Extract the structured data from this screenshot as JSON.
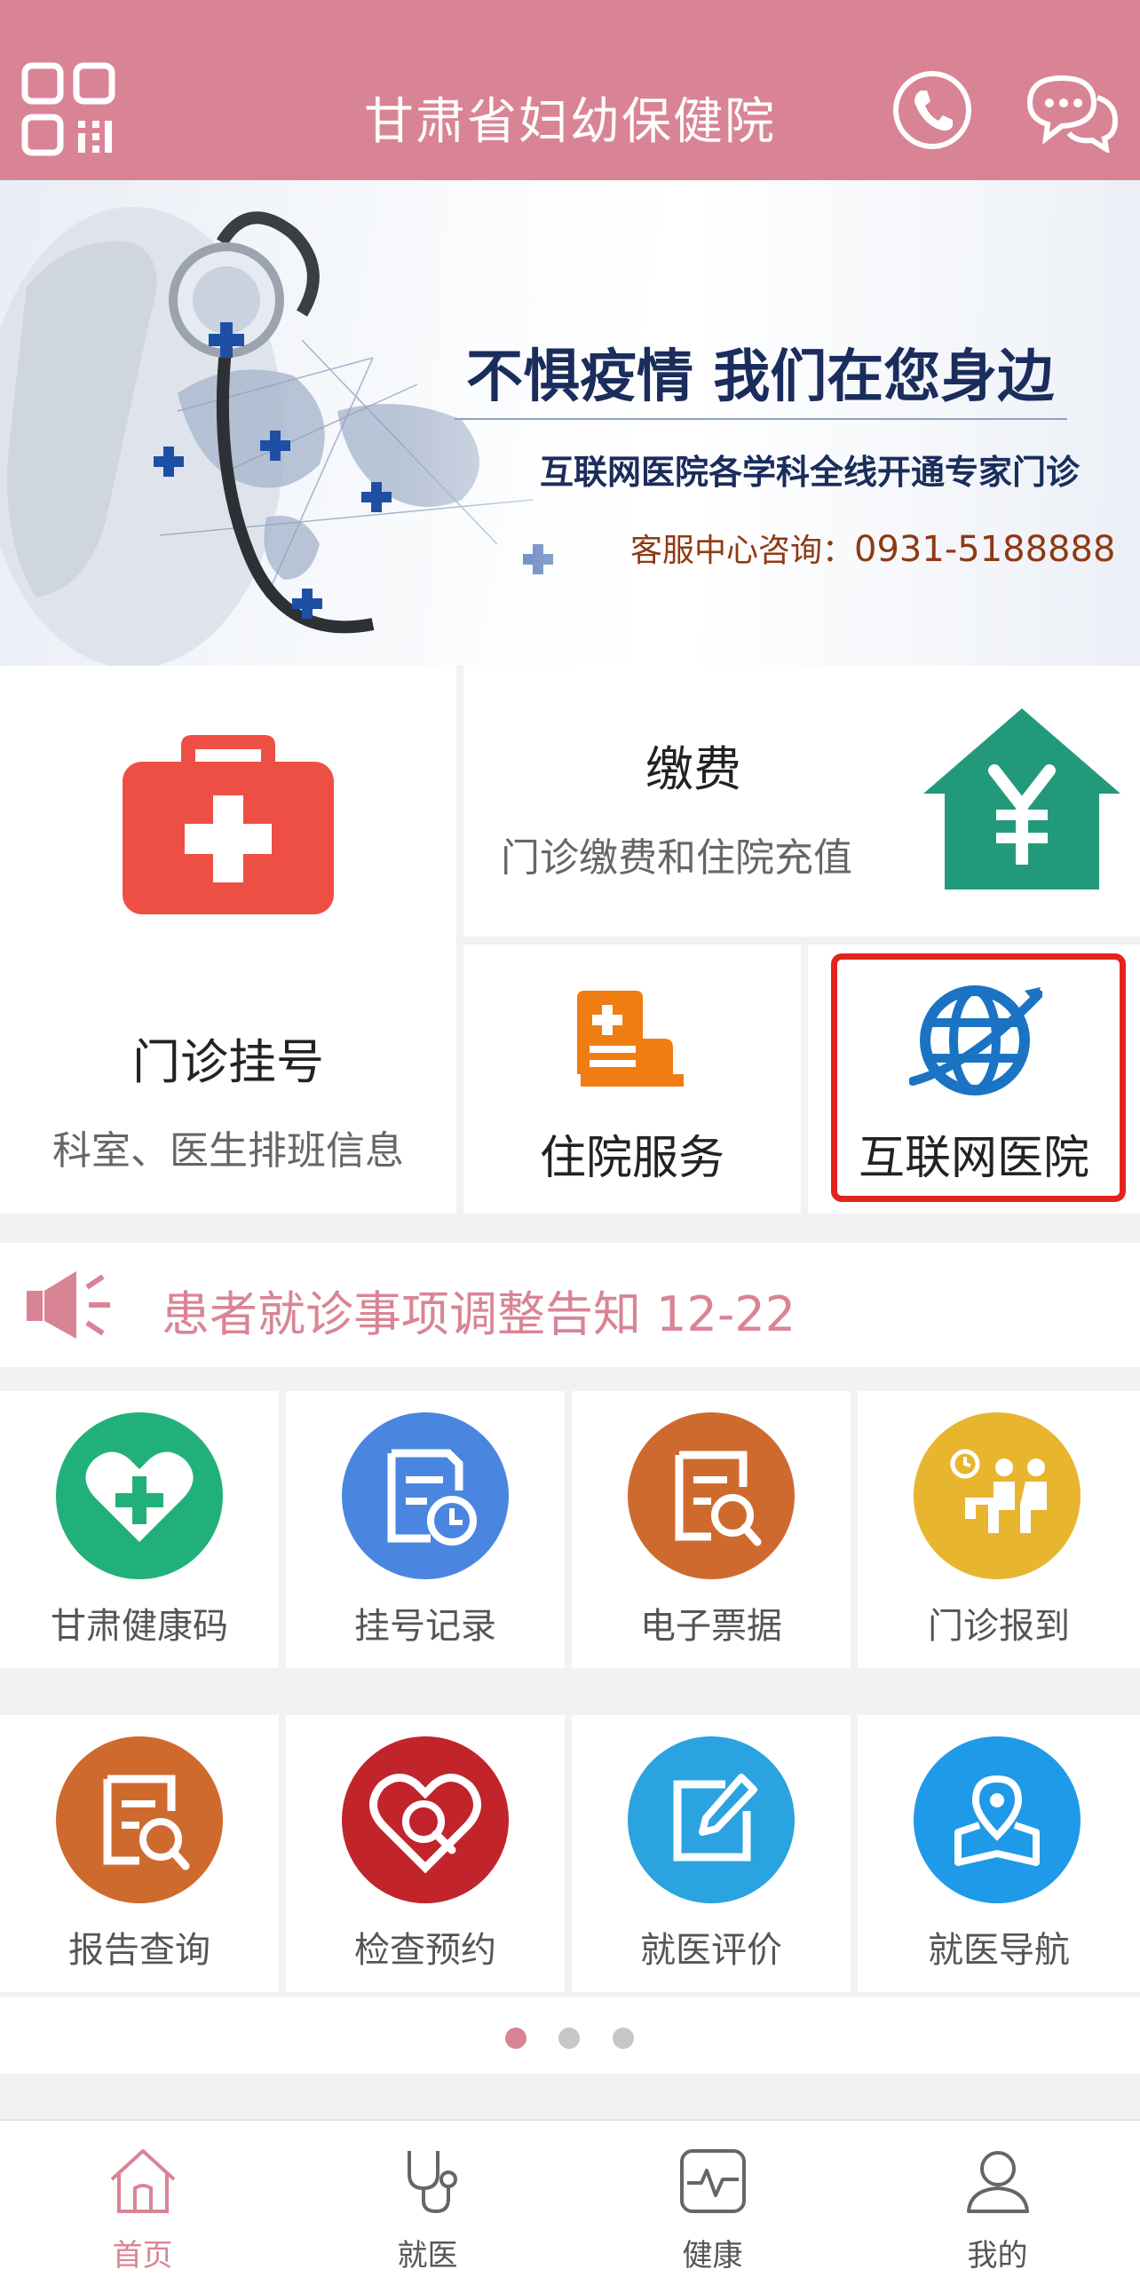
{
  "header": {
    "title": "甘肃省妇幼保健院",
    "icons": [
      "qr-code-icon",
      "phone-icon",
      "chat-icon"
    ]
  },
  "banner": {
    "headline": "不惧疫情  我们在您身边",
    "subline": "互联网医院各学科全线开通专家门诊",
    "service_label": "客服中心咨询：",
    "service_phone": "0931-5188888"
  },
  "services": {
    "registration": {
      "name": "门诊挂号",
      "desc": "科室、医生排班信息",
      "icon": "first-aid-kit-icon",
      "color": "#ee4f45"
    },
    "payment": {
      "name": "缴费",
      "desc": "门诊缴费和住院充值",
      "icon": "yuan-house-icon",
      "color": "#23997c"
    },
    "inpatient": {
      "name": "住院服务",
      "icon": "hospital-bed-icon",
      "color": "#f07d12"
    },
    "internet_hospital": {
      "name": "互联网医院",
      "icon": "globe-icon",
      "color": "#1a73c3",
      "highlight_color": "#e3241c"
    }
  },
  "notice": {
    "text": "患者就诊事项调整告知  12-22",
    "icon": "megaphone-icon"
  },
  "functions": [
    {
      "label": "甘肃健康码",
      "icon": "heart-plus-icon",
      "color": "#22b07a"
    },
    {
      "label": "挂号记录",
      "icon": "record-clock-icon",
      "color": "#4a86e0"
    },
    {
      "label": "电子票据",
      "icon": "receipt-search-icon",
      "color": "#cf6a2e"
    },
    {
      "label": "门诊报到",
      "icon": "waiting-room-icon",
      "color": "#e8b52f"
    },
    {
      "label": "报告查询",
      "icon": "report-search-icon",
      "color": "#cf6a2e"
    },
    {
      "label": "检查预约",
      "icon": "heart-search-icon",
      "color": "#c1242b"
    },
    {
      "label": "就医评价",
      "icon": "edit-review-icon",
      "color": "#2aa3e0"
    },
    {
      "label": "就医导航",
      "icon": "map-pin-icon",
      "color": "#1f9ae8"
    }
  ],
  "pager": {
    "pages": 3,
    "active": 1
  },
  "tabs": [
    {
      "label": "首页",
      "icon": "home-icon",
      "active": true
    },
    {
      "label": "就医",
      "icon": "stethoscope-icon",
      "active": false
    },
    {
      "label": "健康",
      "icon": "health-pulse-icon",
      "active": false
    },
    {
      "label": "我的",
      "icon": "profile-icon",
      "active": false
    }
  ],
  "colors": {
    "brand": "#d98495",
    "tab_active": "#d98495"
  }
}
